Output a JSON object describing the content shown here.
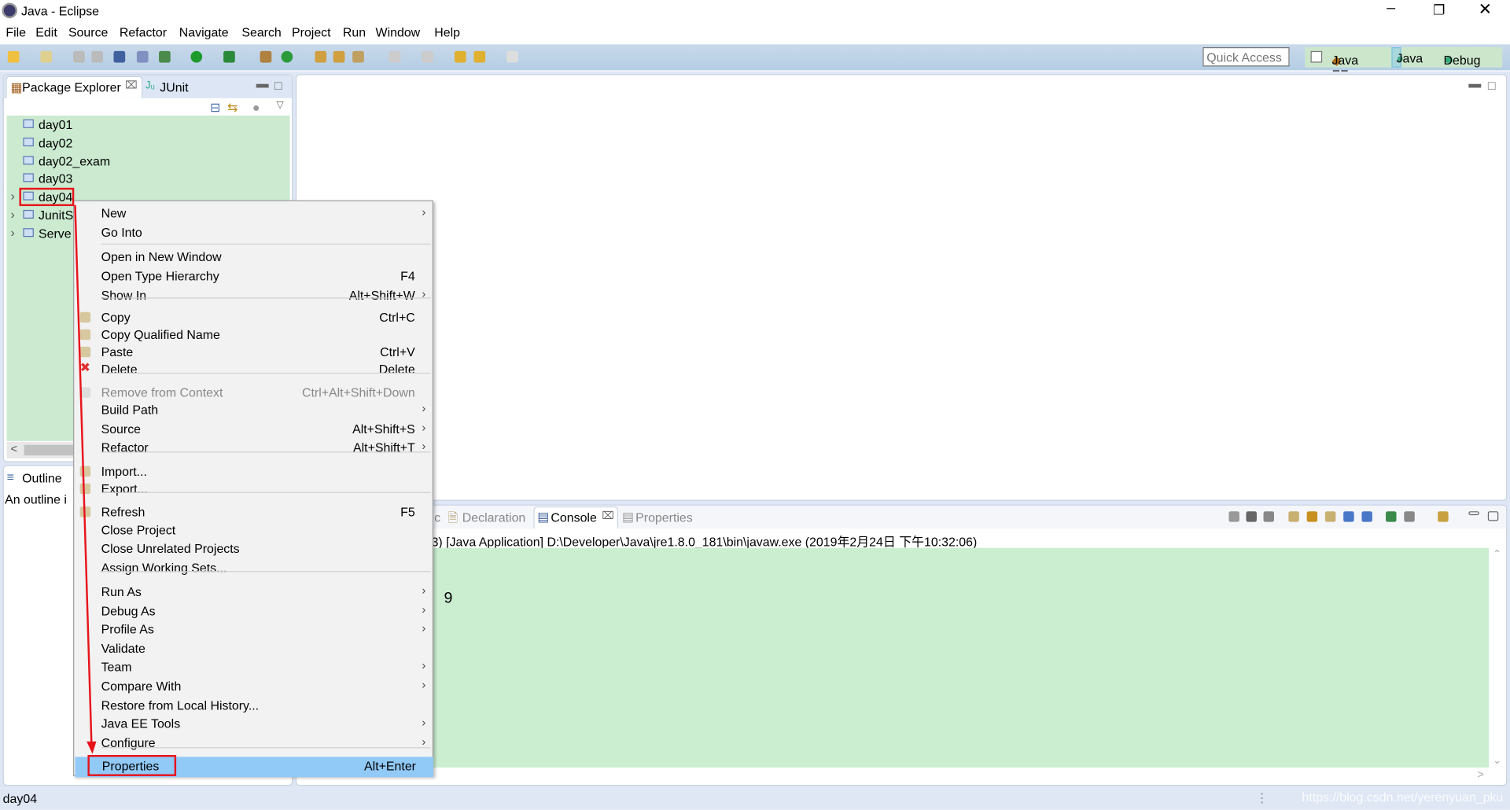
{
  "window": {
    "title": "Java - Eclipse",
    "controls": [
      "minimize",
      "restore",
      "close"
    ]
  },
  "menubar": [
    "File",
    "Edit",
    "Source",
    "Refactor",
    "Navigate",
    "Search",
    "Project",
    "Run",
    "Window",
    "Help"
  ],
  "toolbar": {
    "quick_access_placeholder": "Quick Access",
    "perspectives": [
      "Java EE",
      "Java",
      "Debug"
    ],
    "active_perspective": "Java"
  },
  "left_panel": {
    "tabs": [
      "Package Explorer",
      "JUnit"
    ],
    "active_tab": "Package Explorer",
    "tree": [
      {
        "label": "day01",
        "expandable": false
      },
      {
        "label": "day02",
        "expandable": false
      },
      {
        "label": "day02_exam",
        "expandable": false
      },
      {
        "label": "day03",
        "expandable": false
      },
      {
        "label": "day04",
        "expandable": true,
        "selected": true
      },
      {
        "label": "JunitS",
        "expandable": true
      },
      {
        "label": "Serve",
        "expandable": true
      }
    ]
  },
  "outline": {
    "tab": "Outline",
    "message": "An outline i"
  },
  "bottom_panel": {
    "tabs": [
      "c",
      "Declaration",
      "Console",
      "Properties"
    ],
    "active_tab": "Console",
    "console_header": "3) [Java Application] D:\\Developer\\Java\\jre1.8.0_181\\bin\\javaw.exe (2019年2月24日 下午10:32:06)",
    "console_output": "9"
  },
  "context_menu": {
    "items": [
      {
        "label": "New",
        "submenu": true
      },
      {
        "label": "Go Into"
      },
      {
        "sep": true
      },
      {
        "label": "Open in New Window"
      },
      {
        "label": "Open Type Hierarchy",
        "shortcut": "F4"
      },
      {
        "label": "Show In",
        "shortcut": "Alt+Shift+W",
        "submenu": true
      },
      {
        "sep": true
      },
      {
        "label": "Copy",
        "shortcut": "Ctrl+C",
        "icon": "copy-icon"
      },
      {
        "label": "Copy Qualified Name",
        "icon": "copy-qualified-icon"
      },
      {
        "label": "Paste",
        "shortcut": "Ctrl+V",
        "icon": "paste-icon"
      },
      {
        "label": "Delete",
        "shortcut": "Delete",
        "icon": "delete-icon"
      },
      {
        "sep": true
      },
      {
        "label": "Remove from Context",
        "shortcut": "Ctrl+Alt+Shift+Down",
        "disabled": true,
        "icon": "remove-context-icon"
      },
      {
        "label": "Build Path",
        "submenu": true
      },
      {
        "label": "Source",
        "shortcut": "Alt+Shift+S",
        "submenu": true
      },
      {
        "label": "Refactor",
        "shortcut": "Alt+Shift+T",
        "submenu": true
      },
      {
        "sep": true
      },
      {
        "label": "Import...",
        "icon": "import-icon"
      },
      {
        "label": "Export...",
        "icon": "export-icon"
      },
      {
        "sep": true
      },
      {
        "label": "Refresh",
        "shortcut": "F5",
        "icon": "refresh-icon"
      },
      {
        "label": "Close Project"
      },
      {
        "label": "Close Unrelated Projects"
      },
      {
        "label": "Assign Working Sets..."
      },
      {
        "sep": true
      },
      {
        "label": "Run As",
        "submenu": true
      },
      {
        "label": "Debug As",
        "submenu": true
      },
      {
        "label": "Profile As",
        "submenu": true
      },
      {
        "label": "Validate"
      },
      {
        "label": "Team",
        "submenu": true
      },
      {
        "label": "Compare With",
        "submenu": true
      },
      {
        "label": "Restore from Local History..."
      },
      {
        "label": "Java EE Tools",
        "submenu": true
      },
      {
        "label": "Configure",
        "submenu": true
      },
      {
        "sep": true
      },
      {
        "label": "Properties",
        "shortcut": "Alt+Enter",
        "highlighted": true
      }
    ]
  },
  "statusbar": {
    "text": "day04",
    "watermark": "https://blog.csdn.net/yerenyuan_pku"
  },
  "colors": {
    "tree_bg": "#cbead0",
    "console_bg": "#cbeed1",
    "highlight": "#91c9f7",
    "annotation_red": "#e8141b",
    "toolbar": "#b4cde4"
  }
}
